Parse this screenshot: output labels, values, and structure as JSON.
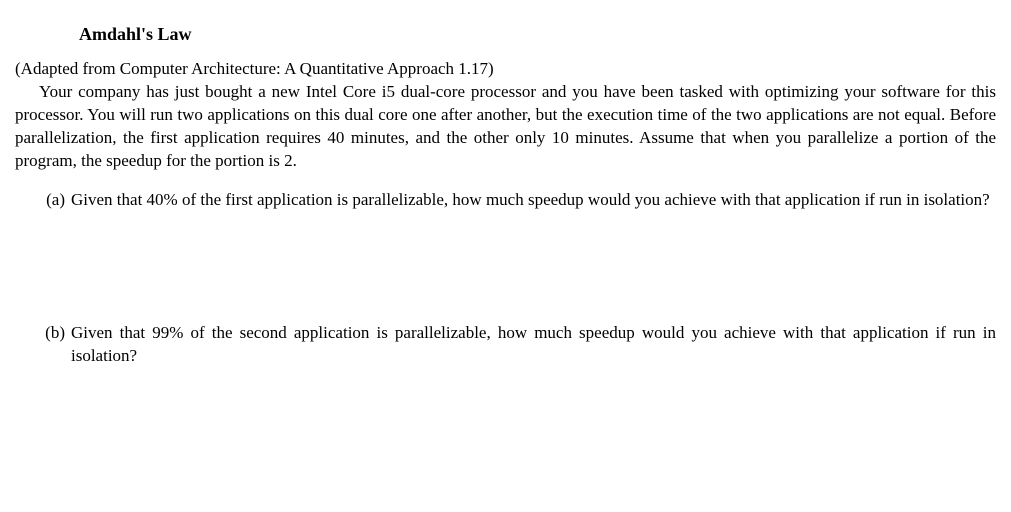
{
  "section": {
    "title": "Amdahl's Law"
  },
  "intro": {
    "source": "(Adapted from Computer Architecture: A Quantitative Approach 1.17)",
    "body": "Your company has just bought a new Intel Core i5 dual-core processor and you have been tasked with optimizing your software for this processor. You will run two applications on this dual core one after another, but the execution time of the two applications are not equal. Before parallelization, the first application requires 40 minutes, and the other only 10 minutes. Assume that when you parallelize a portion of the program, the speedup for the portion is 2."
  },
  "questions": [
    {
      "label": "(a)",
      "text": "Given that 40% of the first application is parallelizable, how much speedup would you achieve with that application if run in isolation?"
    },
    {
      "label": "(b)",
      "text": "Given that 99% of the second application is parallelizable, how much speedup would you achieve with that application if run in isolation?"
    }
  ]
}
